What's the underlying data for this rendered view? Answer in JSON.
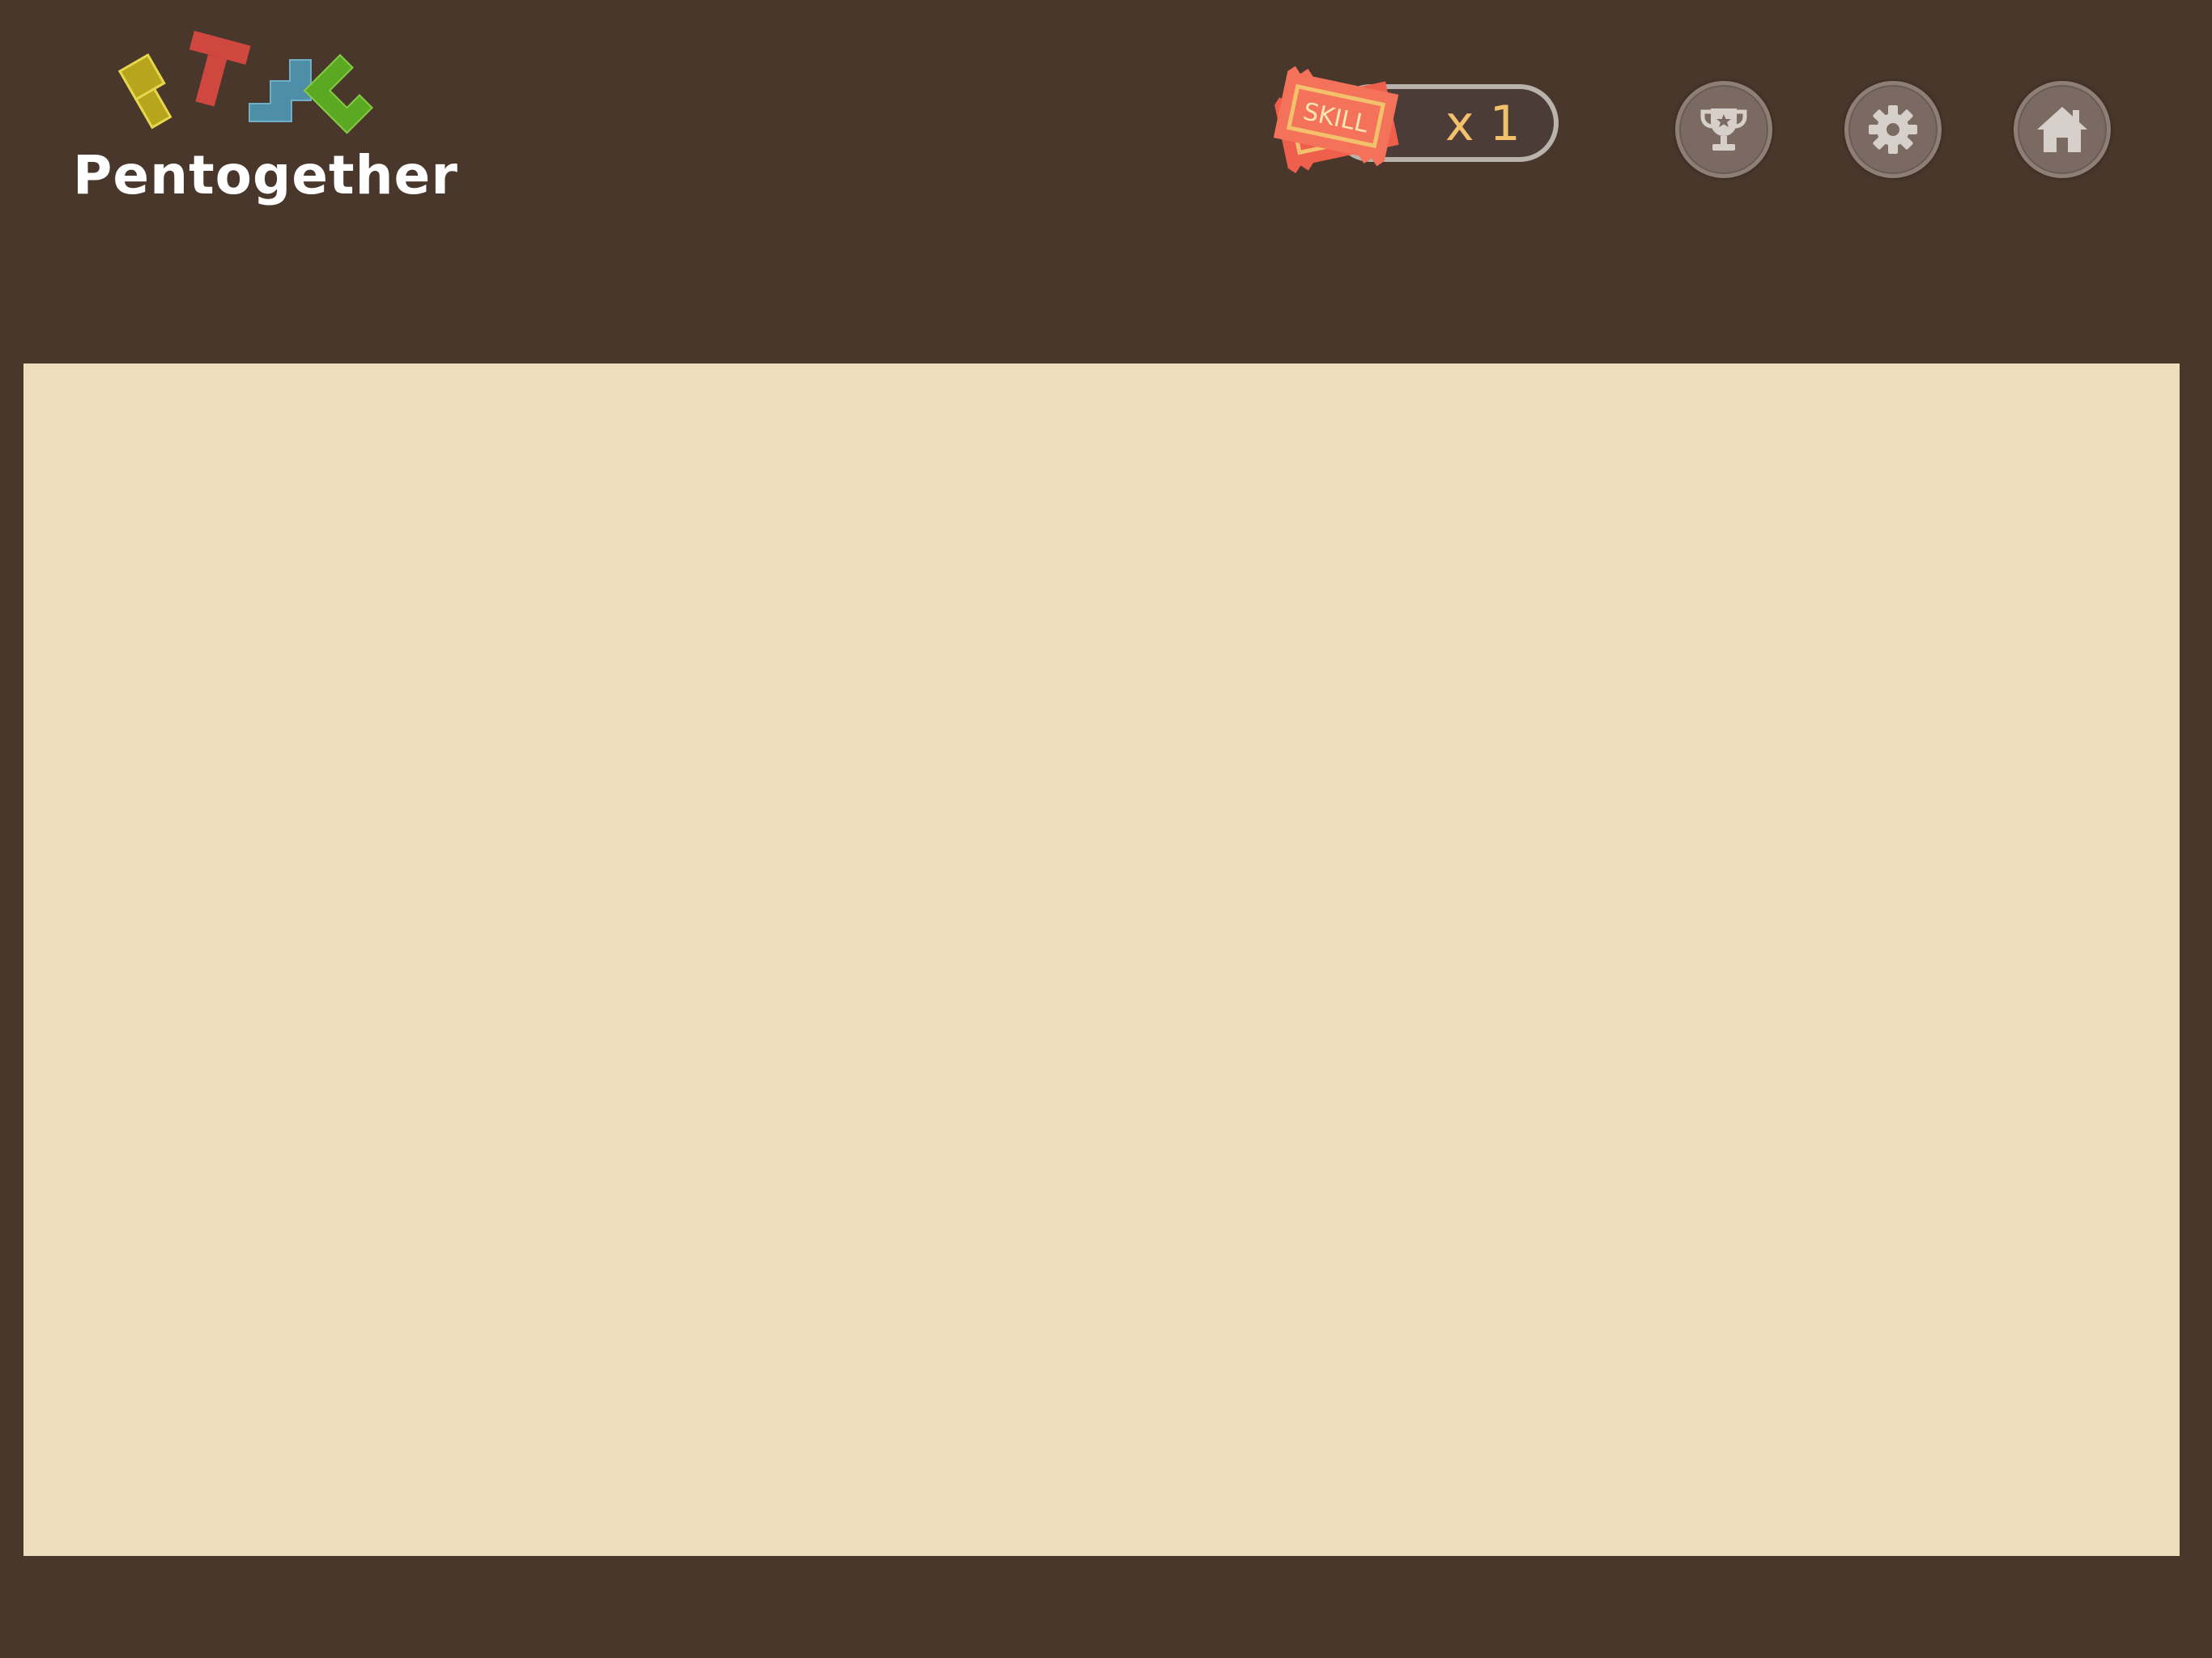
{
  "app": {
    "title": "Pentogether"
  },
  "header": {
    "logo": {
      "title": "Pentogether",
      "pieces": [
        {
          "name": "yellow-pentomino-icon",
          "color": "#b7a51c"
        },
        {
          "name": "red-pentomino-icon",
          "color": "#d0473f"
        },
        {
          "name": "blue-pentomino-icon",
          "color": "#4f8ea7"
        },
        {
          "name": "green-pentomino-icon",
          "color": "#5ba923"
        }
      ]
    },
    "skill": {
      "ticket_label": "SKILL",
      "count_text": "x 1",
      "ticket_color": "#f4715a",
      "count_color": "#f3c06b"
    },
    "buttons": [
      {
        "name": "trophy-button",
        "icon": "trophy-icon"
      },
      {
        "name": "settings-button",
        "icon": "gear-icon"
      },
      {
        "name": "home-button",
        "icon": "home-icon"
      }
    ]
  },
  "board": {
    "color": "#efdcbb"
  },
  "colors": {
    "background": "#4a372b",
    "button_fill": "#7a6a62",
    "icon_fill": "#d7cfca"
  }
}
